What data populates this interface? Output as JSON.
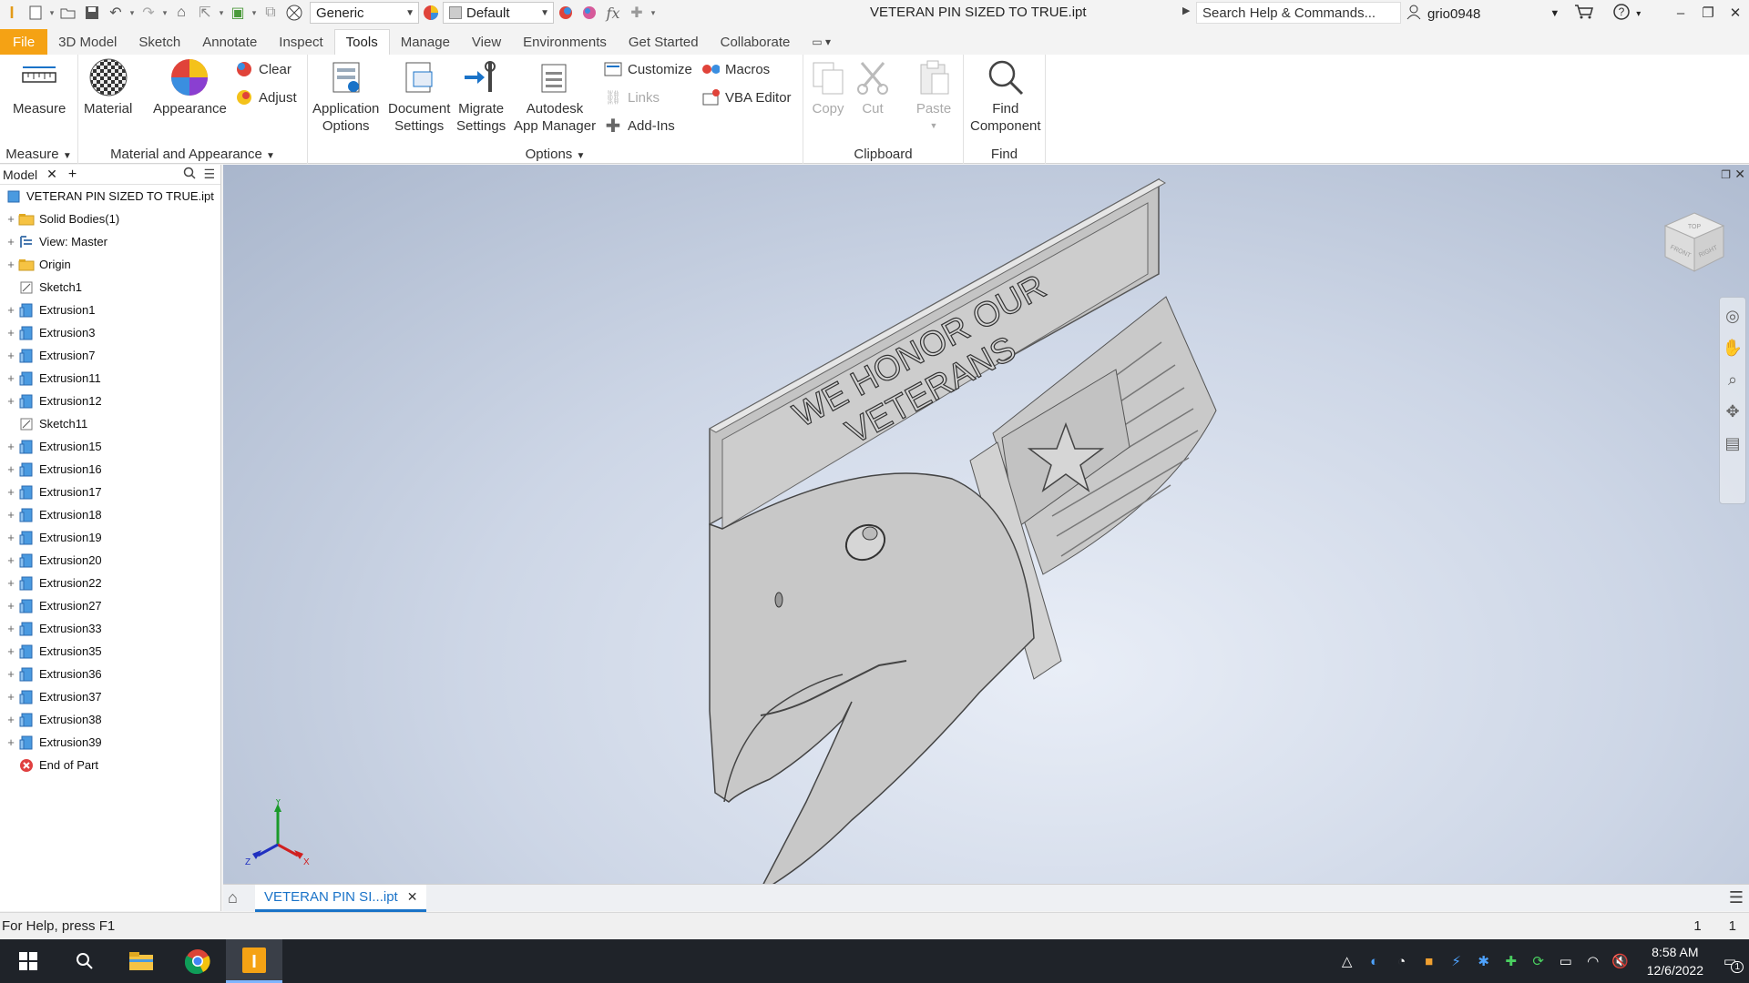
{
  "title_bar": {
    "doc_title": "VETERAN PIN SIZED TO TRUE.ipt",
    "material_combo": "Generic",
    "appearance_combo": "Default",
    "search_placeholder": "Search Help & Commands...",
    "username": "grio0948"
  },
  "tabs": [
    "File",
    "3D Model",
    "Sketch",
    "Annotate",
    "Inspect",
    "Tools",
    "Manage",
    "View",
    "Environments",
    "Get Started",
    "Collaborate"
  ],
  "active_tab": "Tools",
  "ribbon": {
    "measure": {
      "button": "Measure",
      "group": "Measure"
    },
    "material_appearance": {
      "material": "Material",
      "appearance": "Appearance",
      "clear": "Clear",
      "adjust": "Adjust",
      "group": "Material and Appearance"
    },
    "options": {
      "app_options": [
        "Application",
        "Options"
      ],
      "doc_settings": [
        "Document",
        "Settings"
      ],
      "migrate": [
        "Migrate",
        "Settings"
      ],
      "app_manager": [
        "Autodesk",
        "App Manager"
      ],
      "customize": "Customize",
      "links": "Links",
      "addins": "Add-Ins",
      "macros": "Macros",
      "vba": "VBA Editor",
      "group": "Options"
    },
    "clipboard": {
      "copy": "Copy",
      "cut": "Cut",
      "paste": "Paste",
      "group": "Clipboard"
    },
    "find": {
      "button": [
        "Find",
        "Component"
      ],
      "group": "Find"
    }
  },
  "browser": {
    "tab": "Model",
    "items": [
      {
        "label": "VETERAN PIN SIZED TO TRUE.ipt",
        "icon": "part",
        "exp": false,
        "indent": 0
      },
      {
        "label": "Solid Bodies(1)",
        "icon": "folder",
        "exp": true,
        "indent": 1
      },
      {
        "label": "View: Master",
        "icon": "view",
        "exp": true,
        "indent": 1
      },
      {
        "label": "Origin",
        "icon": "folder",
        "exp": true,
        "indent": 1
      },
      {
        "label": "Sketch1",
        "icon": "sketch",
        "exp": false,
        "indent": 1
      },
      {
        "label": "Extrusion1",
        "icon": "extrusion",
        "exp": true,
        "indent": 1
      },
      {
        "label": "Extrusion3",
        "icon": "extrusion",
        "exp": true,
        "indent": 1
      },
      {
        "label": "Extrusion7",
        "icon": "extrusion",
        "exp": true,
        "indent": 1
      },
      {
        "label": "Extrusion11",
        "icon": "extrusion",
        "exp": true,
        "indent": 1
      },
      {
        "label": "Extrusion12",
        "icon": "extrusion",
        "exp": true,
        "indent": 1
      },
      {
        "label": "Sketch11",
        "icon": "sketch",
        "exp": false,
        "indent": 1
      },
      {
        "label": "Extrusion15",
        "icon": "extrusion",
        "exp": true,
        "indent": 1
      },
      {
        "label": "Extrusion16",
        "icon": "extrusion",
        "exp": true,
        "indent": 1
      },
      {
        "label": "Extrusion17",
        "icon": "extrusion",
        "exp": true,
        "indent": 1
      },
      {
        "label": "Extrusion18",
        "icon": "extrusion",
        "exp": true,
        "indent": 1
      },
      {
        "label": "Extrusion19",
        "icon": "extrusion",
        "exp": true,
        "indent": 1
      },
      {
        "label": "Extrusion20",
        "icon": "extrusion",
        "exp": true,
        "indent": 1
      },
      {
        "label": "Extrusion22",
        "icon": "extrusion",
        "exp": true,
        "indent": 1
      },
      {
        "label": "Extrusion27",
        "icon": "extrusion",
        "exp": true,
        "indent": 1
      },
      {
        "label": "Extrusion33",
        "icon": "extrusion",
        "exp": true,
        "indent": 1
      },
      {
        "label": "Extrusion35",
        "icon": "extrusion",
        "exp": true,
        "indent": 1
      },
      {
        "label": "Extrusion36",
        "icon": "extrusion",
        "exp": true,
        "indent": 1
      },
      {
        "label": "Extrusion37",
        "icon": "extrusion",
        "exp": true,
        "indent": 1
      },
      {
        "label": "Extrusion38",
        "icon": "extrusion",
        "exp": true,
        "indent": 1
      },
      {
        "label": "Extrusion39",
        "icon": "extrusion",
        "exp": true,
        "indent": 1
      },
      {
        "label": "End of Part",
        "icon": "end",
        "exp": false,
        "indent": 1
      }
    ]
  },
  "model_text": {
    "line1": "WE HONOR OUR",
    "line2": "VETERANS"
  },
  "viewcube": {
    "top": "TOP",
    "front": "FRONT",
    "right": "RIGHT"
  },
  "triad": {
    "x": "X",
    "y": "Y",
    "z": "Z"
  },
  "doc_tab": "VETERAN PIN SI...ipt",
  "status": {
    "help": "For Help, press F1",
    "n1": "1",
    "n2": "1"
  },
  "clock": {
    "time": "8:58 AM",
    "date": "12/6/2022"
  },
  "notification_count": "1",
  "colors": {
    "file_tab": "#f5a214",
    "accent": "#1a73c8",
    "taskbar": "#1f2329"
  }
}
